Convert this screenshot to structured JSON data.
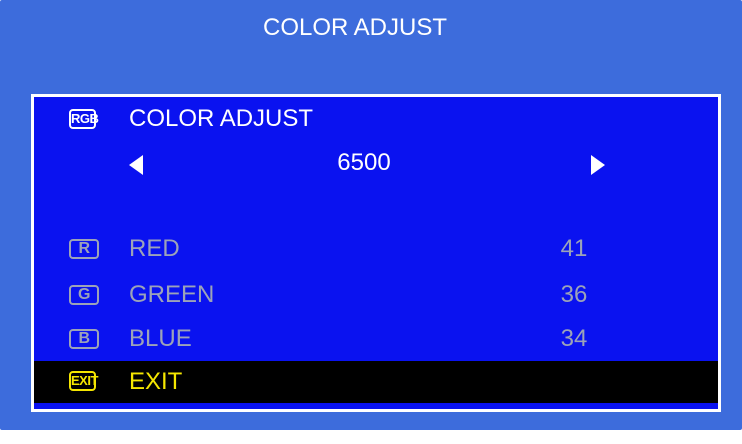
{
  "header": {
    "title": "COLOR ADJUST"
  },
  "panel": {
    "heading": {
      "icon_text": "RGB",
      "icon_name": "rgb-icon",
      "label": "COLOR ADJUST"
    },
    "color_temp": {
      "value": "6500"
    },
    "channels": [
      {
        "icon_text": "R",
        "icon_name": "r-icon",
        "label": "RED",
        "value": "41"
      },
      {
        "icon_text": "G",
        "icon_name": "g-icon",
        "label": "GREEN",
        "value": "36"
      },
      {
        "icon_text": "B",
        "icon_name": "b-icon",
        "label": "BLUE",
        "value": "34"
      }
    ],
    "exit": {
      "icon_text": "EXIT",
      "icon_name": "exit-icon",
      "label": "EXIT"
    }
  },
  "colors": {
    "outer_background": "#3d6cdc",
    "panel_background": "#0a12f0",
    "inactive_text": "#9ca3b8",
    "selected_row_background": "#000000",
    "selected_text": "#f5e600"
  }
}
